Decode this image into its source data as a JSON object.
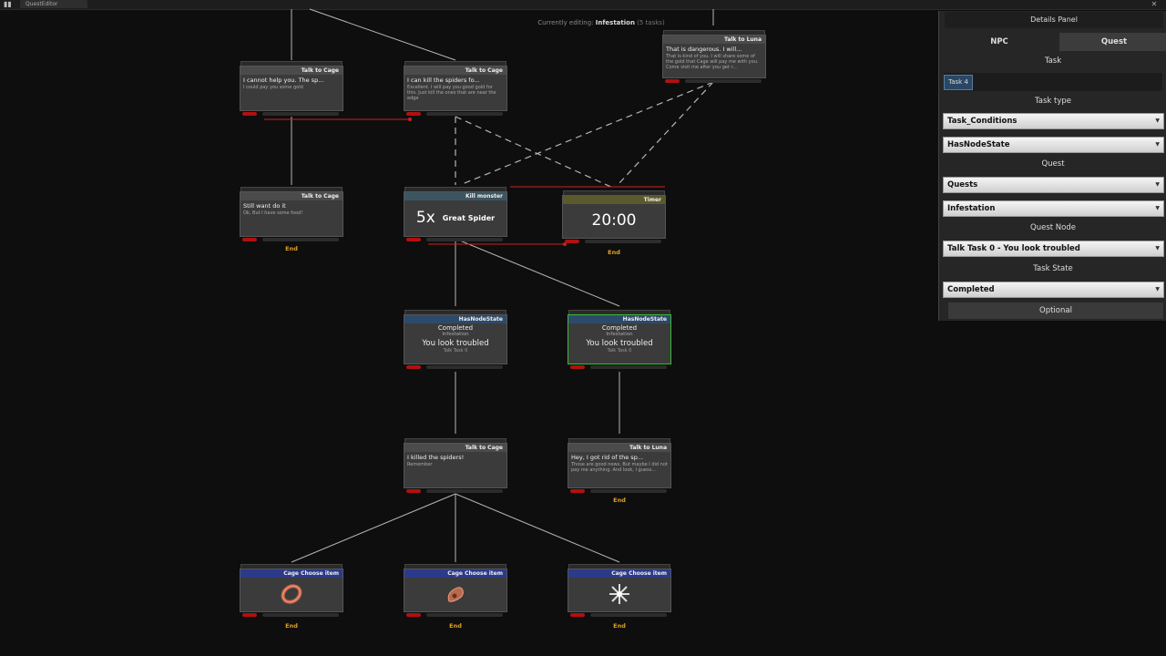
{
  "window": {
    "tab_label": "QuestEditor"
  },
  "header": {
    "editing_label": "Currently editing:",
    "quest_name": "Infestation",
    "count": "(5 tasks)"
  },
  "nodes": [
    {
      "id": "n1",
      "type": "talk",
      "title": "Talk to Cage",
      "line1": "I cannot help you. The sp...",
      "line2": "I could pay you some gold"
    },
    {
      "id": "n2",
      "type": "talk",
      "title": "Talk to Cage",
      "line1": "I can kill the spiders fo...",
      "line2": "Excellent. I will pay you good gold for this. Just kill the ones that are near the edge"
    },
    {
      "id": "n3",
      "type": "talk",
      "title": "Talk to Luna",
      "line1": "That is dangerous. I will...",
      "line2": "That is kind of you. I will share some of the gold that Cage will pay me with you. Come visit me after you get r..."
    },
    {
      "id": "n4",
      "type": "talk",
      "title": "Talk to Cage",
      "line1": "Still want do it",
      "line2": "Ok, But I have some food!",
      "end": "End"
    },
    {
      "id": "n5",
      "type": "kill",
      "title": "Kill monster",
      "count": "5x",
      "target": "Great Spider"
    },
    {
      "id": "n6",
      "type": "timer",
      "title": "Timer",
      "value": "20:00",
      "end": "End"
    },
    {
      "id": "n7",
      "type": "state",
      "title": "HasNodeState",
      "state": "Completed",
      "quest": "Infestation",
      "node": "You look troubled",
      "task": "Talk Task 0"
    },
    {
      "id": "n8",
      "type": "state",
      "title": "HasNodeState",
      "state": "Completed",
      "quest": "Infestation",
      "node": "You look troubled",
      "task": "Talk Task 0"
    },
    {
      "id": "n9",
      "type": "talk",
      "title": "Talk to Cage",
      "line1": "I killed the spiders!",
      "line2": "Remember"
    },
    {
      "id": "n10",
      "type": "talk",
      "title": "Talk to Luna",
      "line1": "Hey, I got rid of the sp...",
      "line2": "Those are good news. But maybe I did not pay me anything. And look, I guess...",
      "end": "End"
    },
    {
      "id": "n11",
      "type": "choose",
      "title": "Cage Choose item",
      "icon": "ring-icon",
      "end": "End"
    },
    {
      "id": "n12",
      "type": "choose",
      "title": "Cage Choose item",
      "icon": "bracelet-icon",
      "end": "End"
    },
    {
      "id": "n13",
      "type": "choose",
      "title": "Cage Choose item",
      "icon": "star-icon",
      "end": "End"
    }
  ],
  "panel": {
    "title": "Details Panel",
    "tabs": [
      "NPC",
      "Quest"
    ],
    "task_label": "Task",
    "task_value": "Task 4",
    "task_type_label": "Task type",
    "task_type_1": "Task_Conditions",
    "task_type_2": "HasNodeState",
    "quest_label": "Quest",
    "quest_1": "Quests",
    "quest_2": "Infestation",
    "quest_node_label": "Quest Node",
    "quest_node_value": "Talk Task 0 - You look troubled",
    "task_state_label": "Task State",
    "task_state_value": "Completed",
    "optional_label": "Optional"
  },
  "colors": {
    "exec_edge": "#cc2020",
    "flow_edge": "#bbbbbb",
    "selected": "#3bbb3b",
    "end_label": "#e0a020"
  }
}
